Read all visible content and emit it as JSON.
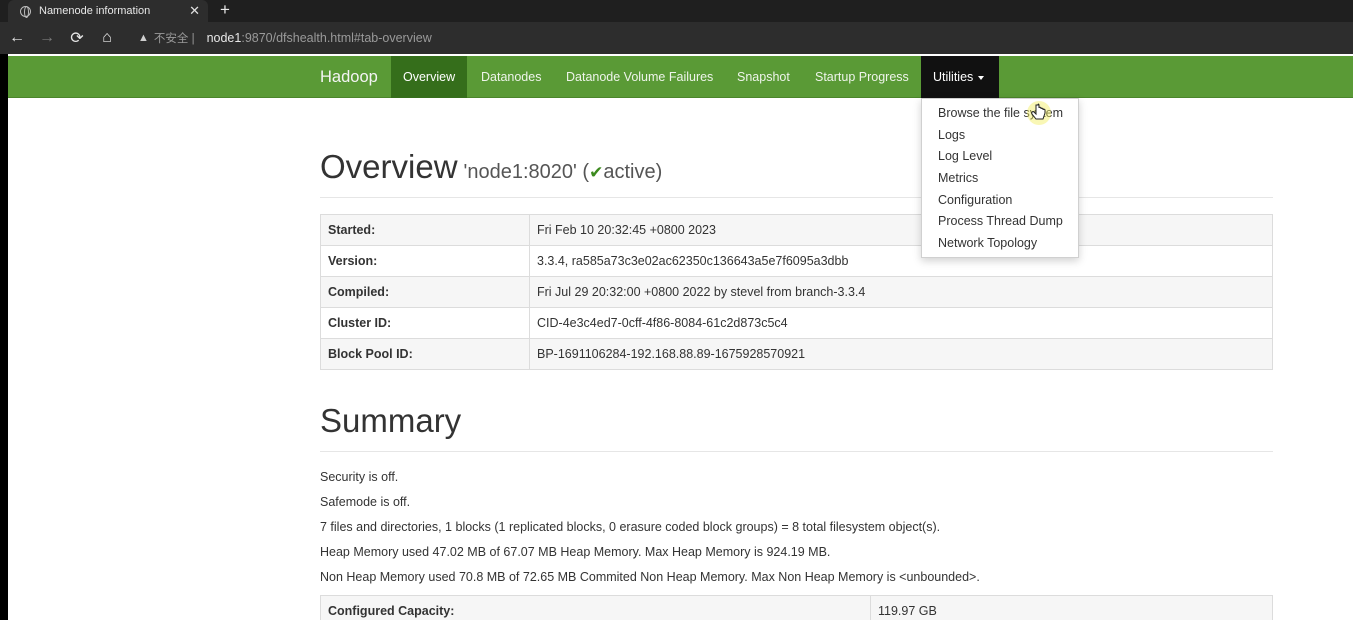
{
  "browser": {
    "tab_title": "Namenode information",
    "tab_close": "✕",
    "new_tab": "+",
    "back_icon": "←",
    "forward_icon": "→",
    "reload_icon": "⟳",
    "home_icon": "⌂",
    "security_warning_icon": "▲",
    "security_label": "不安全 |",
    "url_host": "node1",
    "url_rest": ":9870/dfshealth.html#tab-overview"
  },
  "navbar": {
    "brand": "Hadoop",
    "items": [
      "Overview",
      "Datanodes",
      "Datanode Volume Failures",
      "Snapshot",
      "Startup Progress",
      "Utilities"
    ],
    "active": "Overview",
    "open_menu": "Utilities",
    "color": "#5a9a36"
  },
  "utilities_menu": {
    "items": [
      "Browse the file system",
      "Logs",
      "Log Level",
      "Metrics",
      "Configuration",
      "Process Thread Dump",
      "Network Topology"
    ]
  },
  "overview": {
    "title": "Overview",
    "node": "'node1:8020'",
    "state_open": "(",
    "check_icon": "✔",
    "state": "active",
    "state_close": ")",
    "rows": [
      {
        "key": "Started:",
        "value": "Fri Feb 10 20:32:45 +0800 2023"
      },
      {
        "key": "Version:",
        "value": "3.3.4, ra585a73c3e02ac62350c136643a5e7f6095a3dbb"
      },
      {
        "key": "Compiled:",
        "value": "Fri Jul 29 20:32:00 +0800 2022 by stevel from branch-3.3.4"
      },
      {
        "key": "Cluster ID:",
        "value": "CID-4e3c4ed7-0cff-4f86-8084-61c2d873c5c4"
      },
      {
        "key": "Block Pool ID:",
        "value": "BP-1691106284-192.168.88.89-1675928570921"
      }
    ]
  },
  "summary": {
    "title": "Summary",
    "lines": [
      "Security is off.",
      "Safemode is off.",
      "7 files and directories, 1 blocks (1 replicated blocks, 0 erasure coded block groups) = 8 total filesystem object(s).",
      "Heap Memory used 47.02 MB of 67.07 MB Heap Memory. Max Heap Memory is 924.19 MB.",
      "Non Heap Memory used 70.8 MB of 72.65 MB Commited Non Heap Memory. Max Non Heap Memory is <unbounded>."
    ],
    "table": [
      {
        "key": "Configured Capacity:",
        "value": "119.97 GB"
      }
    ]
  }
}
